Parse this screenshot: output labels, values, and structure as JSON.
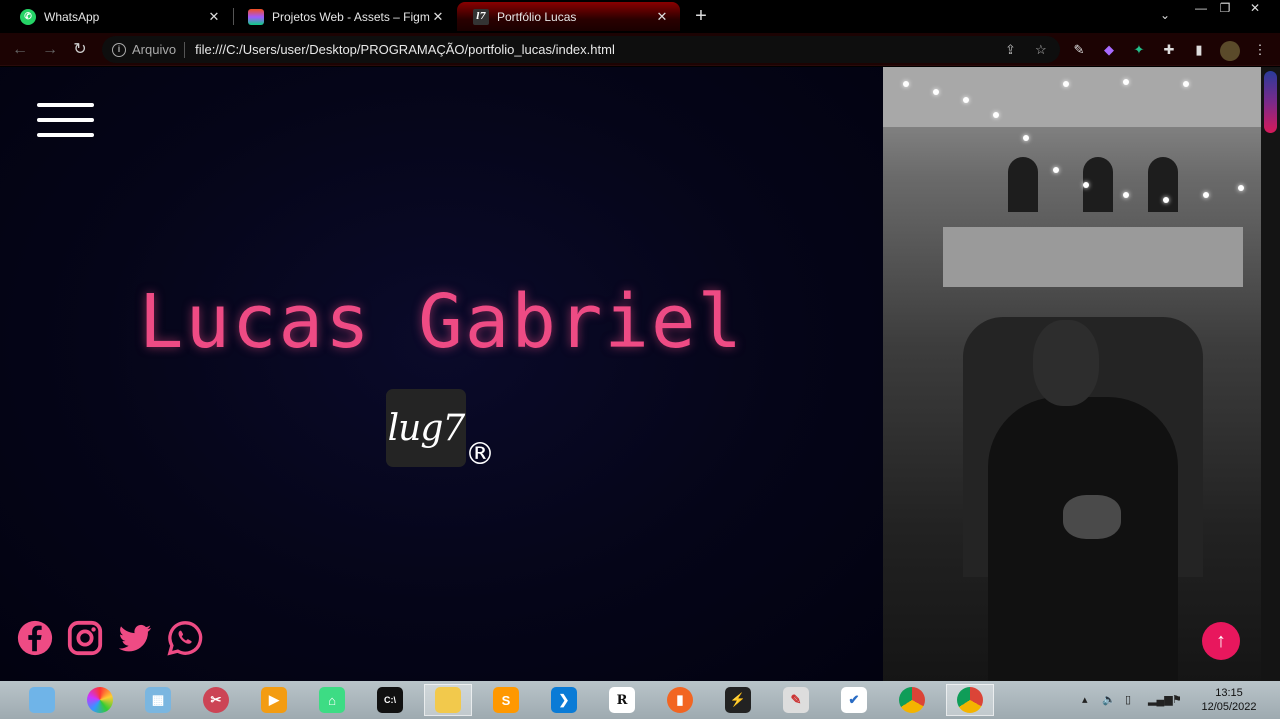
{
  "browser": {
    "tabs": [
      {
        "title": "WhatsApp",
        "icon": "whatsapp-icon",
        "active": false
      },
      {
        "title": "Projetos Web - Assets – Figma",
        "icon": "figma-icon",
        "active": false
      },
      {
        "title": "Portfólio Lucas",
        "icon": "lug7-favicon-icon",
        "active": true
      }
    ],
    "address": {
      "scheme_label": "Arquivo",
      "url": "file:///C:/Users/user/Desktop/PROGRAMAÇÃO/portfolio_lucas/index.html"
    }
  },
  "hero": {
    "name": "Lucas Gabriel",
    "logo_text": "lug7",
    "registered_mark": "®",
    "accent_color": "#ee4b84",
    "socials": [
      "facebook-icon",
      "instagram-icon",
      "twitter-icon",
      "whatsapp-icon"
    ]
  },
  "back_to_top": {
    "label": "↑"
  },
  "taskbar": {
    "apps": [
      "notepad",
      "color-wheel",
      "calculator",
      "snipping-tool",
      "media-player",
      "android-studio",
      "cmd",
      "file-explorer",
      "sublime-text",
      "vscode",
      "rstudio",
      "charts-app",
      "pulse-app",
      "paint",
      "todo",
      "chrome",
      "chrome"
    ],
    "clock_time": "13:15",
    "clock_date": "12/05/2022"
  }
}
